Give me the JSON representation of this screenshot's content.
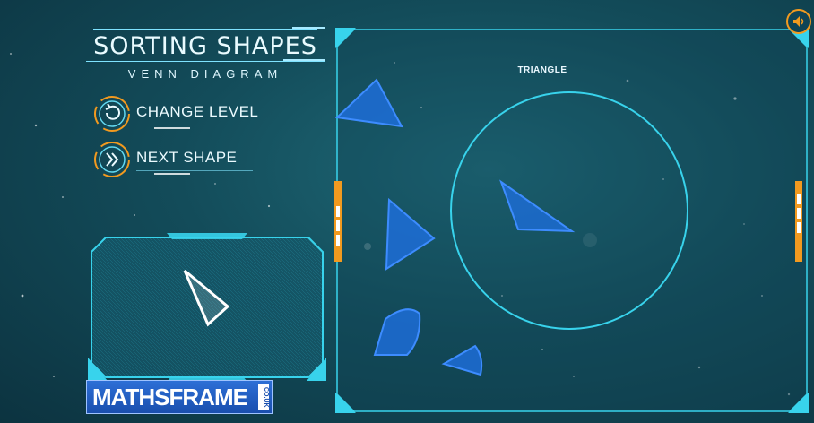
{
  "title": "SORTING SHAPES",
  "subtitle": "VENN DIAGRAM",
  "menu": {
    "change_level": "CHANGE LEVEL",
    "next_shape": "NEXT SHAPE"
  },
  "venn": {
    "set_label": "TRIANGLE"
  },
  "logo": {
    "text": "MATHSFRAME",
    "suffix": "CO.UK"
  },
  "icons": {
    "sound": "speaker-icon",
    "change_level": "cycle-icon",
    "next_shape": "double-chevron-right-icon"
  },
  "colors": {
    "accent": "#38d3ec",
    "orange": "#f29a1f",
    "shape_blue": "#1e6fe0",
    "current_shape": "#ffffff",
    "background": "#134c5a"
  }
}
